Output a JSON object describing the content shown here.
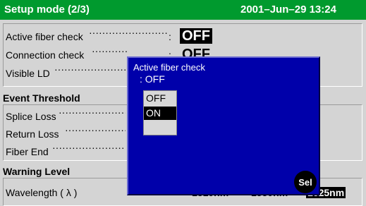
{
  "header": {
    "title": "Setup mode (2/3)",
    "datetime": "2001–Jun–29 13:24"
  },
  "general": {
    "active_fiber_check": {
      "label": "Active fiber check",
      "value": "OFF"
    },
    "connection_check": {
      "label": "Connection check",
      "value": "OFF"
    },
    "visible_ld": {
      "label": "Visible LD"
    }
  },
  "event_threshold": {
    "title": "Event Threshold",
    "splice_loss": {
      "label": "Splice Loss"
    },
    "return_loss": {
      "label": "Return Loss"
    },
    "fiber_end": {
      "label": "Fiber End"
    }
  },
  "warning_level": {
    "title": "Warning Level",
    "wavelength": {
      "label": "Wavelength ( λ )",
      "values": [
        "1310nm",
        "1550nm",
        "1625nm"
      ]
    }
  },
  "dialog": {
    "title": "Active fiber check",
    "current": ": OFF",
    "options": [
      "OFF",
      "ON",
      ""
    ],
    "selected_index": 1,
    "sel_button": "Sel"
  },
  "colors": {
    "title_bar": "#009a2e",
    "dialog_bg": "#0000aa",
    "screen_bg": "#d4d4d4"
  }
}
